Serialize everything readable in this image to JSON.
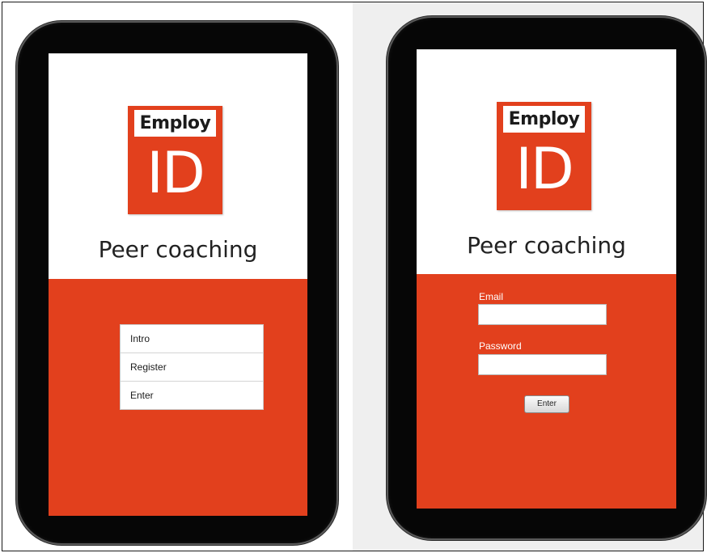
{
  "left_screen": {
    "logo": {
      "word": "Employ",
      "id": "ID"
    },
    "title": "Peer coaching",
    "menu": {
      "items": [
        {
          "label": "Intro"
        },
        {
          "label": "Register"
        },
        {
          "label": "Enter"
        }
      ]
    }
  },
  "right_screen": {
    "logo": {
      "word": "Employ",
      "id": "ID"
    },
    "title": "Peer coaching",
    "form": {
      "email_label": "Email",
      "email_value": "",
      "password_label": "Password",
      "password_value": "",
      "enter_label": "Enter"
    }
  },
  "colors": {
    "brand_orange": "#e2401d",
    "device_bezel": "#060606",
    "background_right": "#efefef"
  }
}
